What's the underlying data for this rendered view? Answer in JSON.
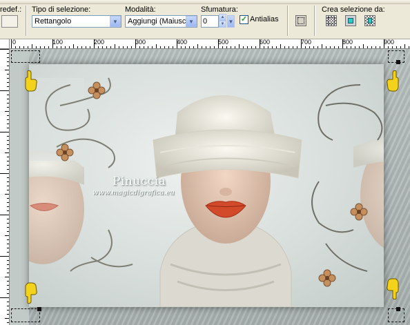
{
  "toolbar": {
    "preset_label": "redef.:",
    "selection_type": {
      "label": "Tipo di selezione:",
      "value": "Rettangolo"
    },
    "mode": {
      "label": "Modalità:",
      "value": "Aggiungi (Maiusc)"
    },
    "feather": {
      "label": "Sfumatura:",
      "value": "0"
    },
    "antialias": {
      "label": "Antialias",
      "checked": true
    },
    "create_selection": {
      "label": "Crea selezione da:"
    }
  },
  "ruler": {
    "labels": [
      "0",
      "100",
      "200",
      "300",
      "400",
      "500",
      "600",
      "700",
      "800",
      "900"
    ]
  },
  "canvas": {
    "watermark_title": "Pinuccia",
    "watermark_url": "www.magicdigrafica.eu"
  },
  "colors": {
    "ui_background": "#ece9d8",
    "canvas_frame": "#a9b3b0",
    "panel": "#dfe5e3",
    "lips": "#d0502c",
    "hand_yellow": "#f2d21a",
    "flower": "#c08a5a"
  },
  "icons": [
    "select-none-icon",
    "from-layer-icon",
    "from-mask-icon",
    "from-transparency-icon",
    "hand-pointer-icon",
    "flower-icon",
    "flourish-icon"
  ]
}
